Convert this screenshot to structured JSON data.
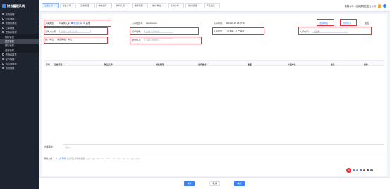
{
  "app": {
    "title": "财务管理系统"
  },
  "sidebar": {
    "items": [
      {
        "label": "采购管理"
      },
      {
        "label": "财务管理"
      },
      {
        "label": "进销存管理"
      },
      {
        "label": "订单管理"
      },
      {
        "label": "进销存管理"
      }
    ],
    "submenu": [
      {
        "label": "物料管理"
      },
      {
        "label": "进货管理"
      },
      {
        "label": "销售管理"
      },
      {
        "label": "退货管理"
      }
    ],
    "items_after": [
      {
        "label": "进销存报表"
      },
      {
        "label": "客户管理"
      },
      {
        "label": "供应商管理"
      },
      {
        "label": "系统管理"
      }
    ]
  },
  "tabs": [
    {
      "label": "设备入库"
    },
    {
      "label": "设备入库"
    },
    {
      "label": "采购管理"
    },
    {
      "label": "物料出库"
    },
    {
      "label": "物料入库"
    },
    {
      "label": "物料管理"
    },
    {
      "label": "推广单位"
    },
    {
      "label": "采购清单"
    },
    {
      "label": "报价管理"
    },
    {
      "label": "产品报表"
    }
  ],
  "top_right": {
    "company": "新疆公司 - 北京德唯正营业公司"
  },
  "form": {
    "type_label": "入库类型：",
    "type_options": [
      {
        "label": "采购入库"
      },
      {
        "label": "收货入库"
      },
      {
        "label": "其他"
      }
    ],
    "handler_label": "入库经办人：",
    "handler_value": "zaoshanren",
    "date_label": "入库时间：",
    "date_value": "2024-11-29 16:57:54",
    "company_label": "采购入公司：",
    "company_placeholder": "请输入采购入公司",
    "order_label": "订单编号：",
    "order_placeholder": "请输入订单编号",
    "category_label": "入库类型：",
    "category_options": [
      {
        "label": "物品"
      },
      {
        "label": "产品类"
      }
    ],
    "warehouse_label": "入库仓库：",
    "warehouse_placeholder": "请选择",
    "unit_label": "推广单位：",
    "unit_value": "请选择推广单位",
    "contract_label": "批量导入：",
    "contract_placeholder": "请输入批量导入"
  },
  "actions": {
    "select_goods": "选择物品",
    "batch_import": "批量导入",
    "back": "返回"
  },
  "table": {
    "headers": [
      {
        "label": "序号",
        "sort": ""
      },
      {
        "label": "设备项目",
        "sort": "☆"
      },
      {
        "label": "物品名称",
        "sort": ""
      },
      {
        "label": "规格型号",
        "sort": ""
      },
      {
        "label": "生产批号",
        "sort": ""
      },
      {
        "label": "数量",
        "sort": ""
      },
      {
        "label": "计量单位",
        "sort": ""
      },
      {
        "label": "备注",
        "sort": "☆"
      },
      {
        "label": "操作",
        "sort": ""
      }
    ]
  },
  "remark": {
    "label": "出库备注：",
    "placeholder": "请输入"
  },
  "attachment": {
    "label": "附件上传：",
    "link": "上传附件",
    "tip": "最多可上传附件类型：jpg、png、pdf、doc、docx、xls、xlsx、zip、rar、ppt、pptx"
  },
  "footer": {
    "save": "保存",
    "cancel": "取消",
    "submit": "确定"
  },
  "colors": {
    "accent": "#3b7ff2",
    "highlight": "#e8303a",
    "sidebar_bg": "#1f2530"
  }
}
